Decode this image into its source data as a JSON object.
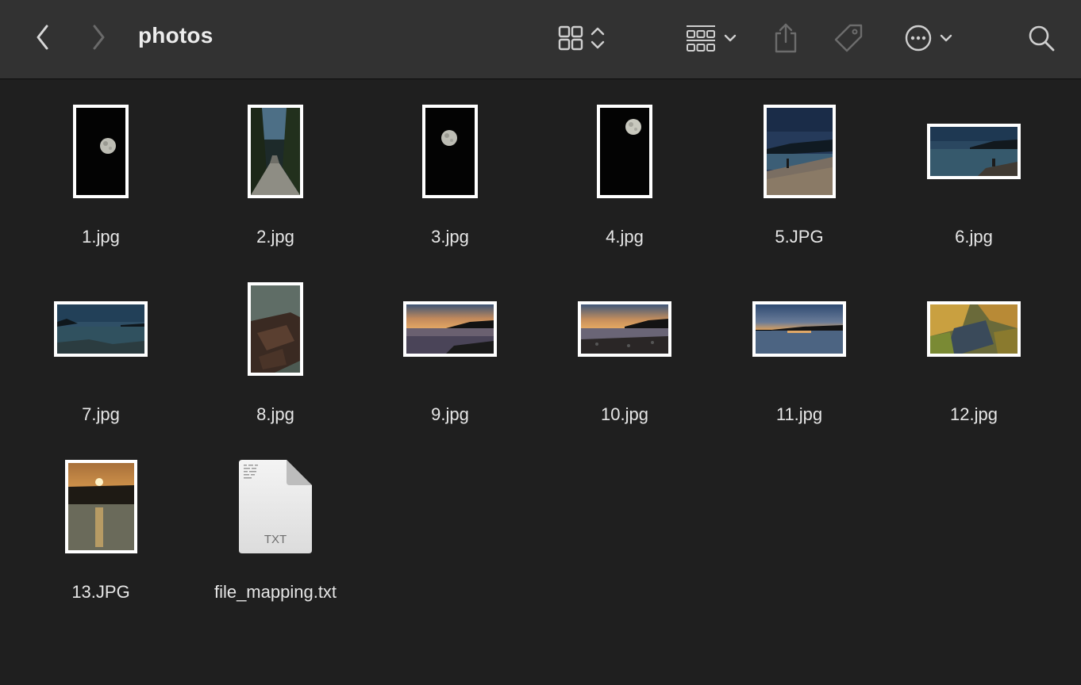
{
  "window": {
    "title": "photos"
  },
  "toolbar": {
    "icons": [
      "back-chevron-icon",
      "forward-chevron-icon",
      "icon-view-grid-icon",
      "group-by-icon",
      "share-icon",
      "tag-icon",
      "more-actions-icon",
      "search-icon"
    ]
  },
  "files": [
    {
      "name": "1.jpg"
    },
    {
      "name": "2.jpg"
    },
    {
      "name": "3.jpg"
    },
    {
      "name": "4.jpg"
    },
    {
      "name": "5.JPG"
    },
    {
      "name": "6.jpg"
    },
    {
      "name": "7.jpg"
    },
    {
      "name": "8.jpg"
    },
    {
      "name": "9.jpg"
    },
    {
      "name": "10.jpg"
    },
    {
      "name": "11.jpg"
    },
    {
      "name": "12.jpg"
    },
    {
      "name": "13.JPG"
    },
    {
      "name": "file_mapping.txt",
      "doc_badge": "TXT"
    }
  ],
  "colors": {
    "background": "#1f1f1f",
    "toolbar": "#323232",
    "text": "#e6e6e6"
  }
}
